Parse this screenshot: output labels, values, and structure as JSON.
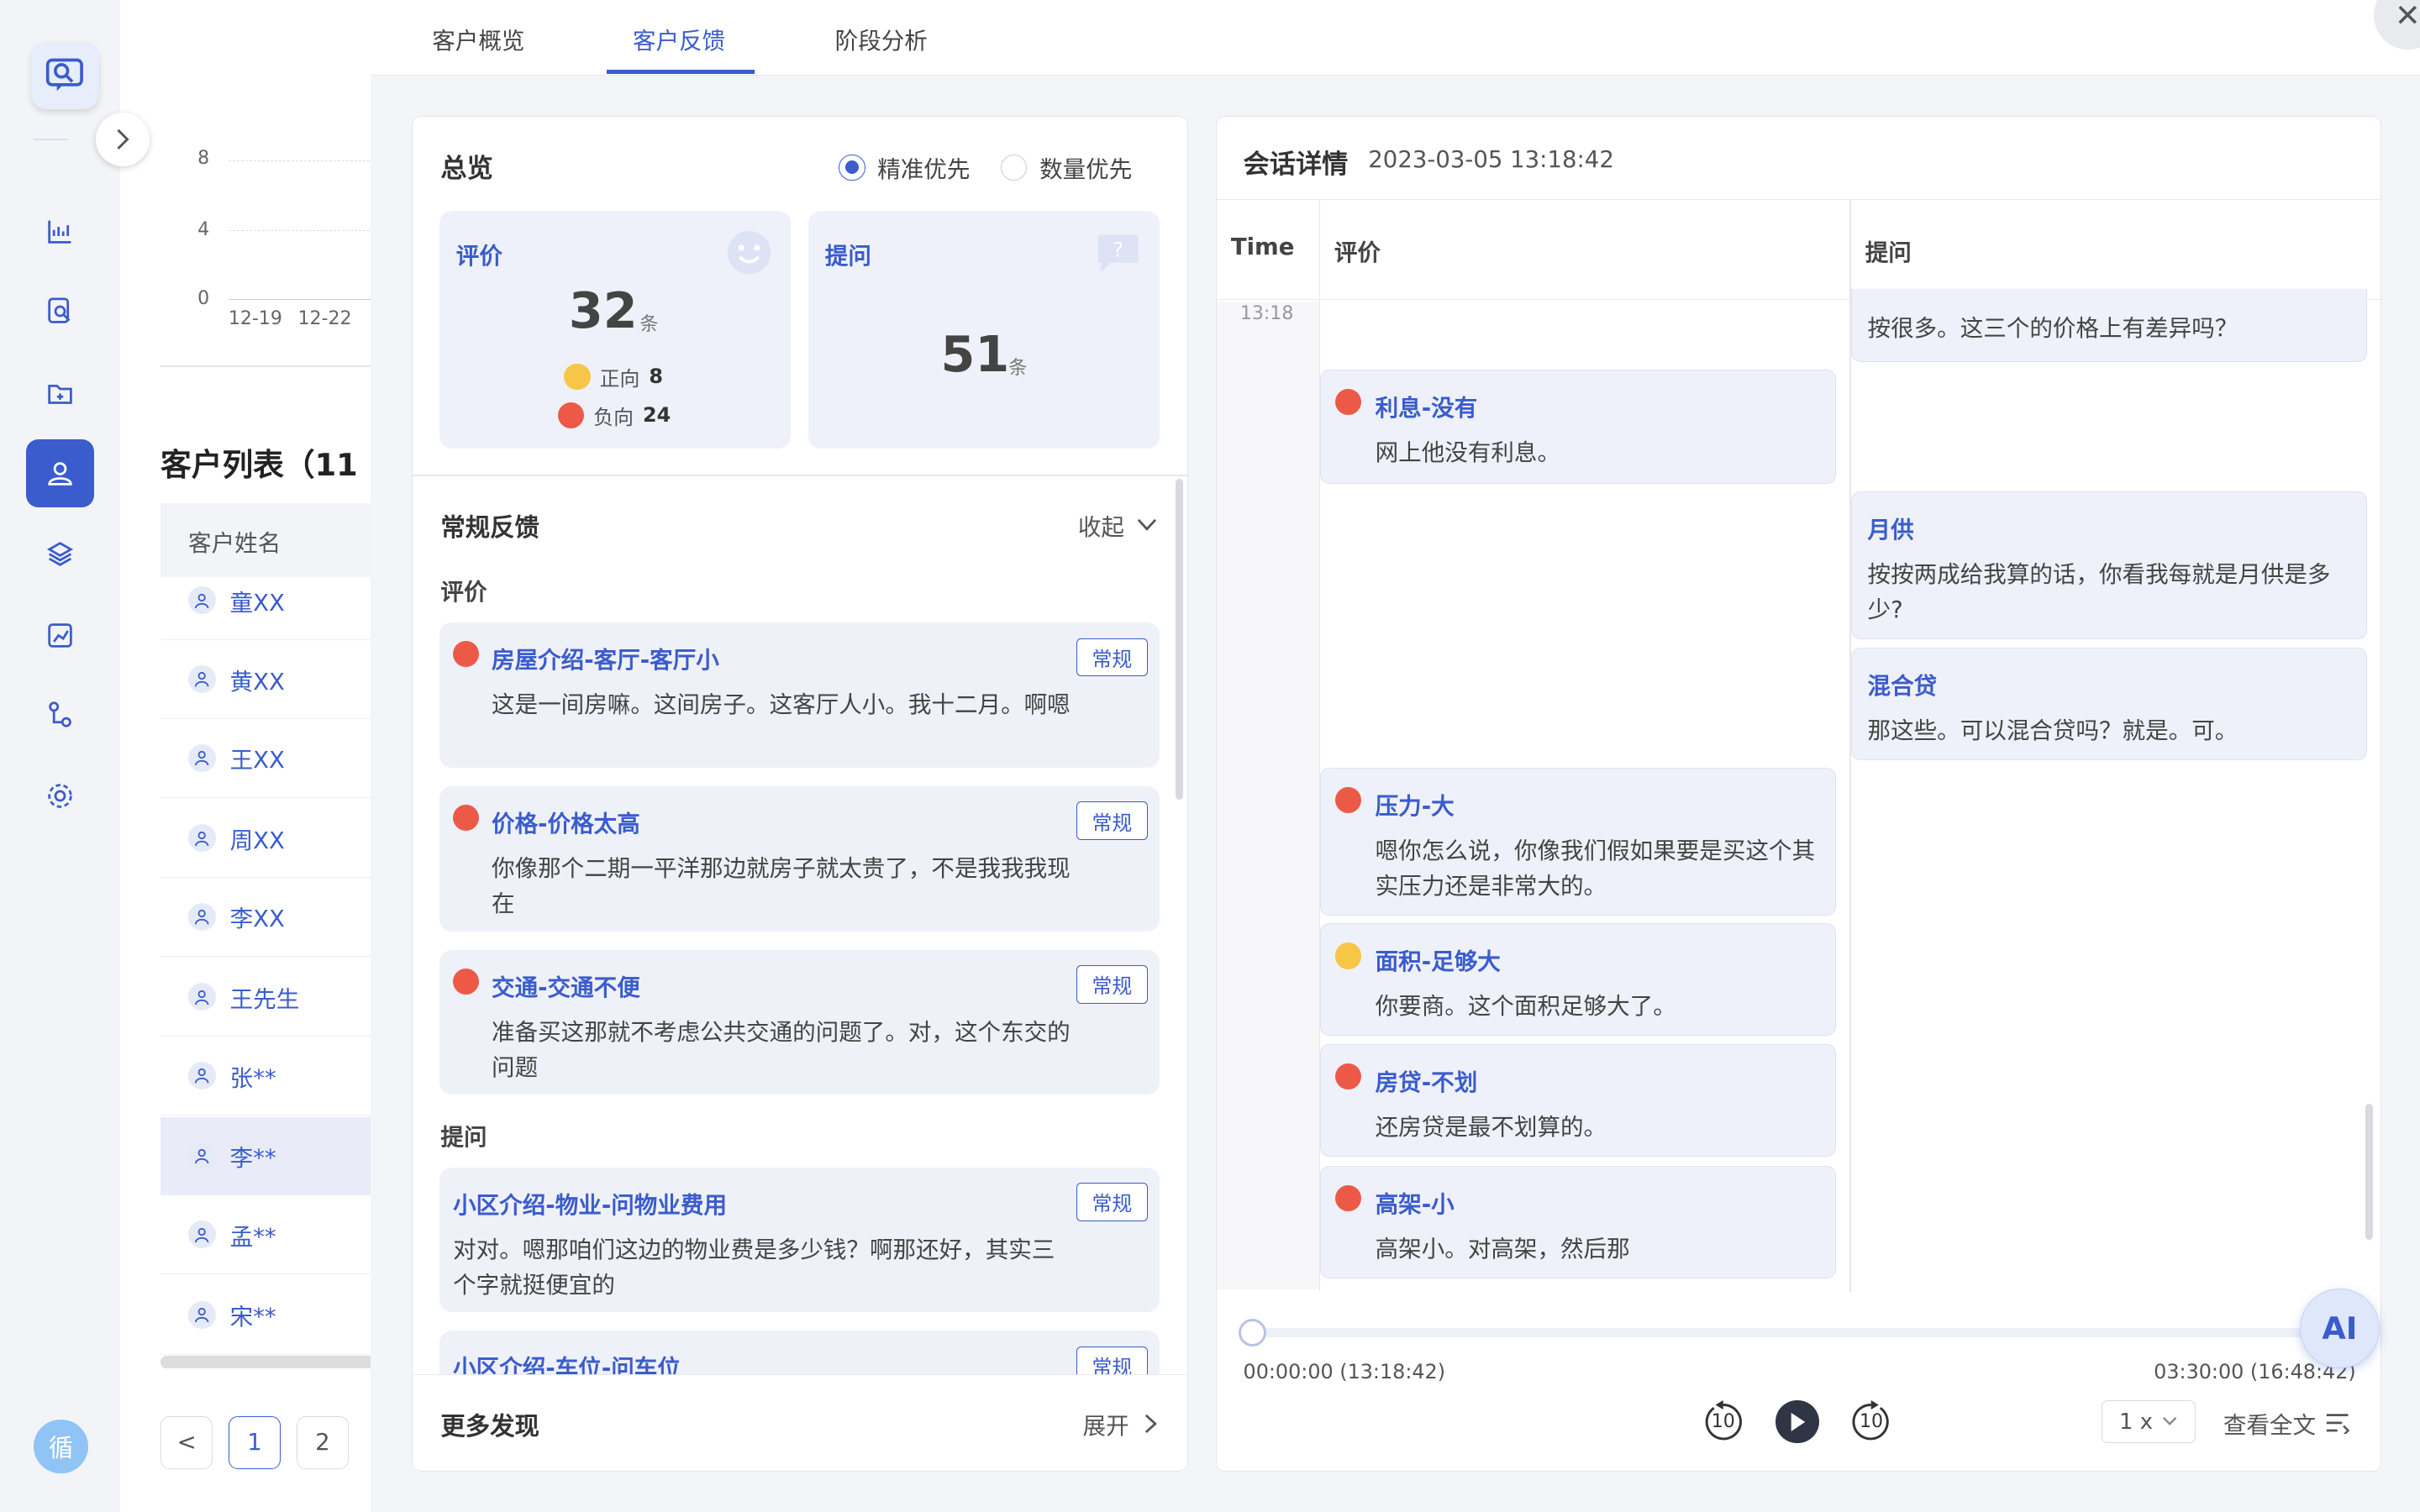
{
  "sidebar": {
    "avatar_text": "循"
  },
  "background": {
    "chart_y_ticks": [
      "8",
      "4",
      "0"
    ],
    "chart_x_ticks": [
      "12-19",
      "12-22"
    ],
    "list_title": "客户列表（11",
    "list_header": "客户姓名",
    "customers": [
      "童XX",
      "黄XX",
      "王XX",
      "周XX",
      "李XX",
      "王先生",
      "张**",
      "李**",
      "孟**",
      "宋**"
    ],
    "selected_customer": "李**",
    "pagination": {
      "prev": "<",
      "pages": [
        "1",
        "2"
      ],
      "current": "1"
    }
  },
  "tabs": [
    "客户概览",
    "客户反馈",
    "阶段分析"
  ],
  "active_tab": "客户反馈",
  "overview": {
    "title": "总览",
    "radio_options": [
      "精准优先",
      "数量优先"
    ],
    "selected_radio": "精准优先",
    "eval_card": {
      "title": "评价",
      "count": "32",
      "unit": "条",
      "positive_label": "正向",
      "positive_count": "8",
      "negative_label": "负向",
      "negative_count": "24"
    },
    "question_card": {
      "title": "提问",
      "count": "51",
      "unit": "条"
    }
  },
  "regular_feedback": {
    "title": "常规反馈",
    "toggle_label": "收起",
    "eval_section": "评价",
    "eval_items": [
      {
        "title": "房屋介绍-客厅-客厅小",
        "text": "这是一间房嘛。这间房子。这客厅人小。我十二月。啊嗯",
        "tag": "常规",
        "sentiment": "negative"
      },
      {
        "title": "价格-价格太高",
        "text": "你像那个二期一平洋那边就房子就太贵了，不是我我我现在",
        "tag": "常规",
        "sentiment": "negative"
      },
      {
        "title": "交通-交通不便",
        "text": "准备买这那就不考虑公共交通的问题了。对，这个东交的问题",
        "tag": "常规",
        "sentiment": "negative"
      }
    ],
    "question_section": "提问",
    "question_items": [
      {
        "title": "小区介绍-物业-问物业费用",
        "text": "对对。嗯那咱们这边的物业费是多少钱？啊那还好，其实三个字就挺便宜的",
        "tag": "常规"
      },
      {
        "title": "小区介绍-车位-问车位",
        "text": "",
        "tag": "常规"
      }
    ]
  },
  "more_findings": {
    "title": "更多发现",
    "toggle_label": "展开"
  },
  "session": {
    "title": "会话详情",
    "datetime": "2023-03-05 13:18:42",
    "columns": [
      "Time",
      "评价",
      "提问"
    ],
    "time_stamp": "13:18",
    "question_partial": "按很多。这三个的价格上有差异吗？",
    "eval_bubbles": [
      {
        "title": "利息-没有",
        "text": "网上他没有利息。",
        "sentiment": "negative"
      },
      {
        "title": "压力-大",
        "text": "嗯你怎么说，你像我们假如果要是买这个其实压力还是非常大的。",
        "sentiment": "negative"
      },
      {
        "title": "面积-足够大",
        "text": "你要商。这个面积足够大了。",
        "sentiment": "positive"
      },
      {
        "title": "房贷-不划",
        "text": "还房贷是最不划算的。",
        "sentiment": "negative"
      },
      {
        "title": "高架-小",
        "text": "高架小。对高架，然后那",
        "sentiment": "negative"
      }
    ],
    "question_bubbles": [
      {
        "title": "月供",
        "text": "按按两成给我算的话，你看我每就是月供是多少?"
      },
      {
        "title": "混合贷",
        "text": "那这些。可以混合贷吗？就是。可。"
      }
    ]
  },
  "player": {
    "progress": 0,
    "start_time": "00:00:00 (13:18:42)",
    "end_time": "03:30:00 (16:48:42)",
    "rewind_label": "10",
    "forward_label": "10",
    "speed": "1 x",
    "full_text_label": "查看全文"
  },
  "ai_button": "AI",
  "colors": {
    "accent": "#3a5ccc",
    "negative": "#ec5a47",
    "positive": "#f7c646"
  }
}
